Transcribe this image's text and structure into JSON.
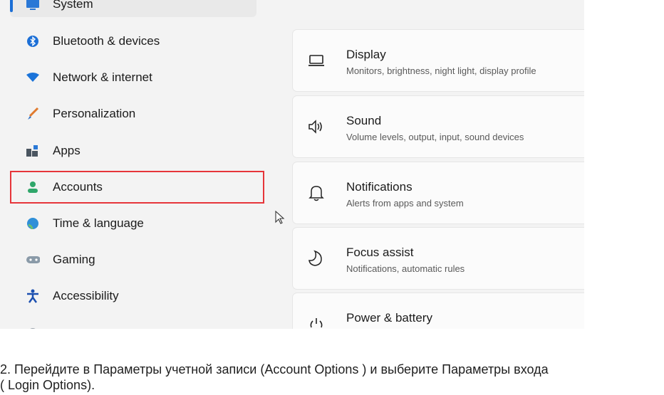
{
  "sidebar": {
    "items": [
      {
        "label": "System",
        "icon": "monitor-icon",
        "selected": true
      },
      {
        "label": "Bluetooth & devices",
        "icon": "bluetooth-icon"
      },
      {
        "label": "Network & internet",
        "icon": "wifi-icon"
      },
      {
        "label": "Personalization",
        "icon": "brush-icon"
      },
      {
        "label": "Apps",
        "icon": "apps-icon"
      },
      {
        "label": "Accounts",
        "icon": "person-icon",
        "highlighted": true
      },
      {
        "label": "Time & language",
        "icon": "globe-icon"
      },
      {
        "label": "Gaming",
        "icon": "gamepad-icon"
      },
      {
        "label": "Accessibility",
        "icon": "accessibility-icon"
      }
    ]
  },
  "settings": [
    {
      "title": "Display",
      "subtitle": "Monitors, brightness, night light, display profile",
      "icon": "laptop-icon"
    },
    {
      "title": "Sound",
      "subtitle": "Volume levels, output, input, sound devices",
      "icon": "speaker-icon"
    },
    {
      "title": "Notifications",
      "subtitle": "Alerts from apps and system",
      "icon": "bell-icon"
    },
    {
      "title": "Focus assist",
      "subtitle": "Notifications, automatic rules",
      "icon": "moon-icon"
    },
    {
      "title": "Power & battery",
      "subtitle": "",
      "icon": "power-icon"
    }
  ],
  "colors": {
    "accent": "#1c6fd6",
    "highlight_border": "#e6353a"
  },
  "caption": {
    "line1": "2. Перейдите в  Параметры учетной записи (Account Options ) и выберите Параметры входа",
    "line2": "( Login Options)."
  }
}
